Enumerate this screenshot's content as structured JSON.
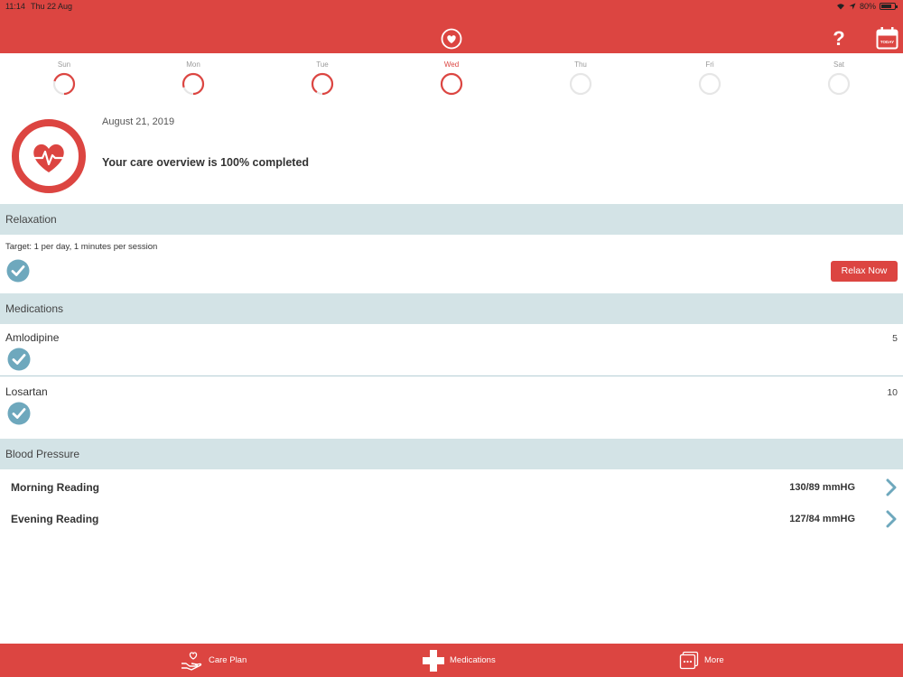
{
  "status_bar": {
    "time": "11:14",
    "date": "Thu 22 Aug",
    "battery": "80%",
    "battery_level": 0.8
  },
  "header": {
    "logo_icon": "heart-icon",
    "help_label": "?",
    "calendar_icon": "calendar-today-icon",
    "calendar_label": "TODAY"
  },
  "week": {
    "days": [
      {
        "label": "Sun",
        "progress": 0.7
      },
      {
        "label": "Mon",
        "progress": 0.8
      },
      {
        "label": "Tue",
        "progress": 0.9
      },
      {
        "label": "Wed",
        "progress": 1.0,
        "active": true
      },
      {
        "label": "Thu",
        "progress": 0
      },
      {
        "label": "Fri",
        "progress": 0
      },
      {
        "label": "Sat",
        "progress": 0
      }
    ]
  },
  "overview": {
    "date": "August 21, 2019",
    "message": "Your care overview is 100% completed",
    "completion": 1.0,
    "icon": "heart-pulse-icon"
  },
  "relaxation": {
    "header": "Relaxation",
    "target": "Target: 1 per day, 1 minutes per session",
    "checked": true,
    "button": "Relax Now"
  },
  "medications": {
    "header": "Medications",
    "items": [
      {
        "name": "Amlodipine",
        "quantity": "5",
        "checked": true
      },
      {
        "name": "Losartan",
        "quantity": "10",
        "checked": true
      }
    ]
  },
  "blood_pressure": {
    "header": "Blood Pressure",
    "readings": [
      {
        "label": "Morning Reading",
        "value": "130/89 mmHG"
      },
      {
        "label": "Evening Reading",
        "value": "127/84 mmHG"
      }
    ]
  },
  "tabs": [
    {
      "label": "Care Plan",
      "icon": "care-plan-icon"
    },
    {
      "label": "Medications",
      "icon": "medical-cross-icon"
    },
    {
      "label": "More",
      "icon": "more-icon"
    }
  ],
  "colors": {
    "accent": "#dc4541",
    "section_bg": "#d3e3e6",
    "check": "#6ea8bd"
  }
}
